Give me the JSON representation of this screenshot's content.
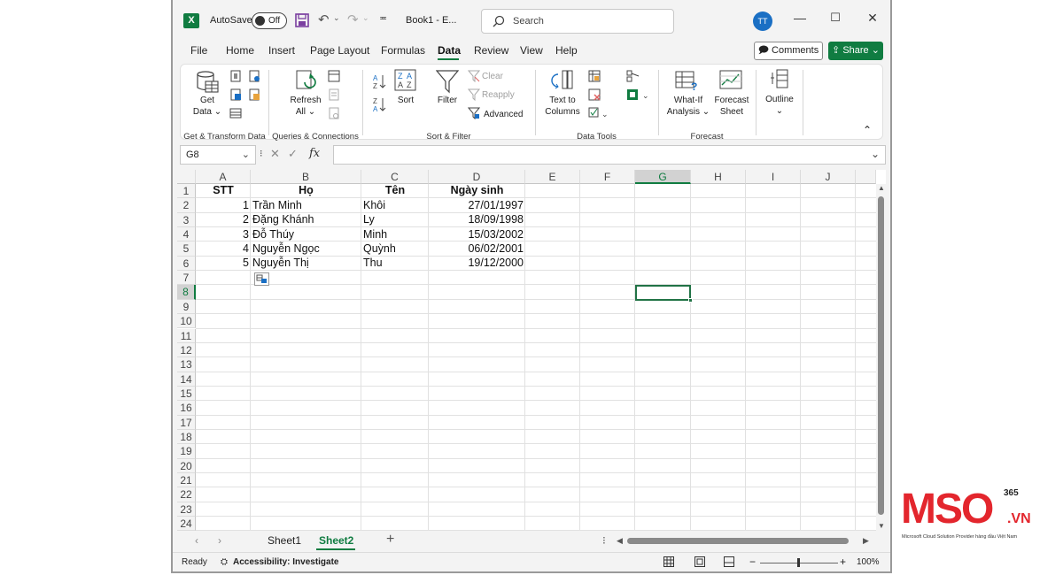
{
  "titlebar": {
    "autosave_label": "AutoSave",
    "autosave_state": "Off",
    "filename": "Book1 - E...",
    "search_placeholder": "Search",
    "user_initials": "TT"
  },
  "menu": {
    "items": [
      "File",
      "Home",
      "Insert",
      "Page Layout",
      "Formulas",
      "Data",
      "Review",
      "View",
      "Help"
    ],
    "active": "Data",
    "comments": "Comments",
    "share": "Share"
  },
  "ribbon": {
    "get_data_1": "Get",
    "get_data_2": "Data",
    "refresh_1": "Refresh",
    "refresh_2": "All",
    "sort": "Sort",
    "filter": "Filter",
    "clear": "Clear",
    "reapply": "Reapply",
    "advanced": "Advanced",
    "text_to_1": "Text to",
    "text_to_2": "Columns",
    "whatif_1": "What-If",
    "whatif_2": "Analysis",
    "forecast_1": "Forecast",
    "forecast_2": "Sheet",
    "outline": "Outline",
    "groups": {
      "get_transform": "Get & Transform Data",
      "queries": "Queries & Connections",
      "sort_filter": "Sort & Filter",
      "data_tools": "Data Tools",
      "forecast": "Forecast"
    }
  },
  "formula_bar": {
    "name_box": "G8",
    "fx": "fx",
    "content": ""
  },
  "sheet": {
    "columns": [
      "A",
      "B",
      "C",
      "D",
      "E",
      "F",
      "G",
      "H",
      "I",
      "J"
    ],
    "selected_column": "G",
    "selected_row": 8,
    "rows": [
      "1",
      "2",
      "3",
      "4",
      "5",
      "6",
      "7",
      "8",
      "9",
      "10",
      "11",
      "12",
      "13",
      "14",
      "15",
      "16",
      "17",
      "18",
      "19",
      "20",
      "21",
      "22",
      "23",
      "24"
    ],
    "headers": [
      "STT",
      "Họ",
      "Tên",
      "Ngày sinh"
    ],
    "data": [
      [
        "1",
        "Trần Minh",
        "Khôi",
        "27/01/1997"
      ],
      [
        "2",
        "Đặng Khánh",
        "Ly",
        "18/09/1998"
      ],
      [
        "3",
        "Đỗ Thúy",
        "Minh",
        "15/03/2002"
      ],
      [
        "4",
        "Nguyễn Ngọc",
        "Quỳnh",
        "06/02/2001"
      ],
      [
        "5",
        "Nguyễn Thị",
        "Thu",
        "19/12/2000"
      ]
    ]
  },
  "tabs": {
    "sheets": [
      "Sheet1",
      "Sheet2"
    ],
    "active": "Sheet2"
  },
  "status": {
    "ready": "Ready",
    "accessibility": "Accessibility: Investigate",
    "zoom": "100%"
  },
  "logo": {
    "brand": "MSO",
    "sup": "365",
    "tld": ".VN",
    "tagline": "Microsoft Cloud Solution Provider hàng đầu Việt Nam",
    "color": "#e3262d"
  }
}
